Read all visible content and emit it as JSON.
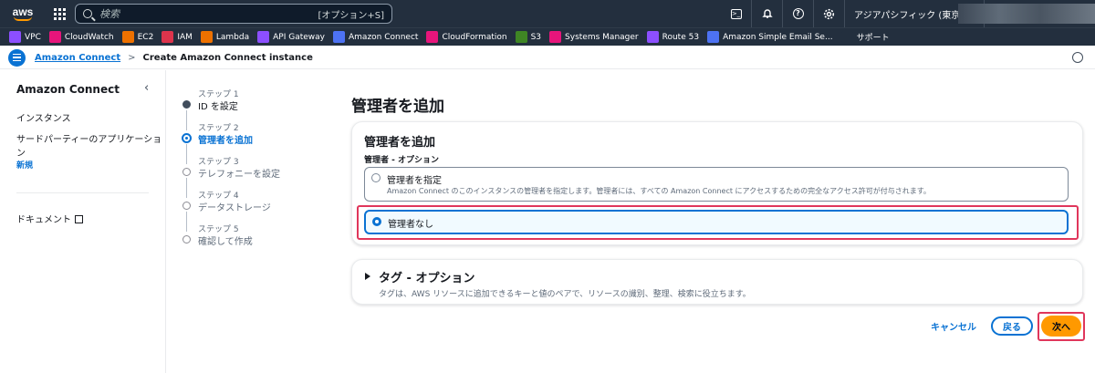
{
  "topnav": {
    "logo_text": "aws",
    "search_placeholder": "検索",
    "search_shortcut": "[オプション+S]",
    "region": "アジアパシフィック (東京) ▾"
  },
  "favorites": [
    {
      "label": "VPC",
      "color": "#8c4fff",
      "icon": "vpc-icon"
    },
    {
      "label": "CloudWatch",
      "color": "#e7157b",
      "icon": "cloudwatch-icon"
    },
    {
      "label": "EC2",
      "color": "#ed7100",
      "icon": "ec2-icon"
    },
    {
      "label": "IAM",
      "color": "#dd344c",
      "icon": "iam-icon"
    },
    {
      "label": "Lambda",
      "color": "#ed7100",
      "icon": "lambda-icon"
    },
    {
      "label": "API Gateway",
      "color": "#8c4fff",
      "icon": "api-gateway-icon"
    },
    {
      "label": "Amazon Connect",
      "color": "#4d72f3",
      "icon": "amazon-connect-icon"
    },
    {
      "label": "CloudFormation",
      "color": "#e7157b",
      "icon": "cloudformation-icon"
    },
    {
      "label": "S3",
      "color": "#3f8624",
      "icon": "s3-icon"
    },
    {
      "label": "Systems Manager",
      "color": "#e7157b",
      "icon": "systems-manager-icon"
    },
    {
      "label": "Route 53",
      "color": "#8c4fff",
      "icon": "route53-icon"
    },
    {
      "label": "Amazon Simple Email Se...",
      "color": "#4d72f3",
      "icon": "ses-icon"
    },
    {
      "label": "サポート",
      "color": "#232f3e",
      "icon": "support-icon"
    }
  ],
  "breadcrumb": {
    "link": "Amazon Connect",
    "separator": ">",
    "current": "Create Amazon Connect instance"
  },
  "sidenav": {
    "title": "Amazon Connect",
    "collapse": "‹",
    "items": [
      "インスタンス",
      "サードパーティーのアプリケーション"
    ],
    "new_badge": "新規",
    "docs": "ドキュメント"
  },
  "steps": [
    {
      "label": "ステップ 1",
      "name": "ID を設定",
      "state": "done"
    },
    {
      "label": "ステップ 2",
      "name": "管理者を追加",
      "state": "active"
    },
    {
      "label": "ステップ 3",
      "name": "テレフォニーを設定",
      "state": "pending"
    },
    {
      "label": "ステップ 4",
      "name": "データストレージ",
      "state": "pending"
    },
    {
      "label": "ステップ 5",
      "name": "確認して作成",
      "state": "pending"
    }
  ],
  "main": {
    "page_title": "管理者を追加",
    "admin_card": {
      "title": "管理者を追加",
      "field_label": "管理者 - オプション",
      "option1_title": "管理者を指定",
      "option1_desc": "Amazon Connect のこのインスタンスの管理者を指定します。管理者には、すべての Amazon Connect にアクセスするための完全なアクセス許可が付与されます。",
      "option2_title": "管理者なし",
      "selected": "option2"
    },
    "tags_card": {
      "title": "タグ - オプション",
      "desc": "タグは、AWS リソースに追加できるキーと値のペアで、リソースの識別、整理、検索に役立ちます。"
    }
  },
  "actions": {
    "cancel": "キャンセル",
    "back": "戻る",
    "next": "次へ"
  }
}
